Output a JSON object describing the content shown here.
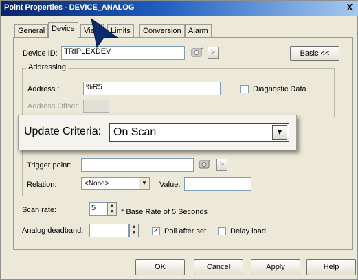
{
  "window": {
    "title": "Point Properties - DEVICE_ANALOG",
    "close_glyph": "X"
  },
  "tabs": [
    {
      "label": "General"
    },
    {
      "label": "Device"
    },
    {
      "label": "View"
    },
    {
      "label": "Limits"
    },
    {
      "label": "Conversion"
    },
    {
      "label": "Alarm"
    }
  ],
  "device": {
    "id_label": "Device ID:",
    "id_value": "TRIPLEXDEV",
    "more_glyph": ">",
    "basic_button": "Basic <<"
  },
  "addressing": {
    "group_title": "Addressing",
    "address_label": "Address :",
    "address_value": "%R5",
    "diagnostic_label": "Diagnostic Data",
    "diagnostic_checked": false,
    "offset_label": "Address Offset:"
  },
  "update_criteria": {
    "label": "Update Criteria:",
    "value": "On Scan",
    "arrow_glyph": "▼"
  },
  "trigger": {
    "point_label": "Trigger point:",
    "point_value": "",
    "more_glyph": ">",
    "relation_label": "Relation:",
    "relation_value": "<None>",
    "value_label": "Value:",
    "value_value": ""
  },
  "scan": {
    "rate_label": "Scan rate:",
    "rate_value": "5",
    "base_rate_note": "* Base Rate of 5 Seconds",
    "deadband_label": "Analog deadband:",
    "deadband_value": "",
    "poll_after_set_label": "Poll after set",
    "poll_after_set_checked": true,
    "delay_load_label": "Delay load",
    "delay_load_checked": false
  },
  "footer": {
    "ok": "OK",
    "cancel": "Cancel",
    "apply": "Apply",
    "help": "Help"
  },
  "colors": {
    "titlebar_start": "#0a246a",
    "titlebar_end": "#a6caf0",
    "dialog_bg": "#ece9d8",
    "pointer": "#0c2a6e"
  }
}
